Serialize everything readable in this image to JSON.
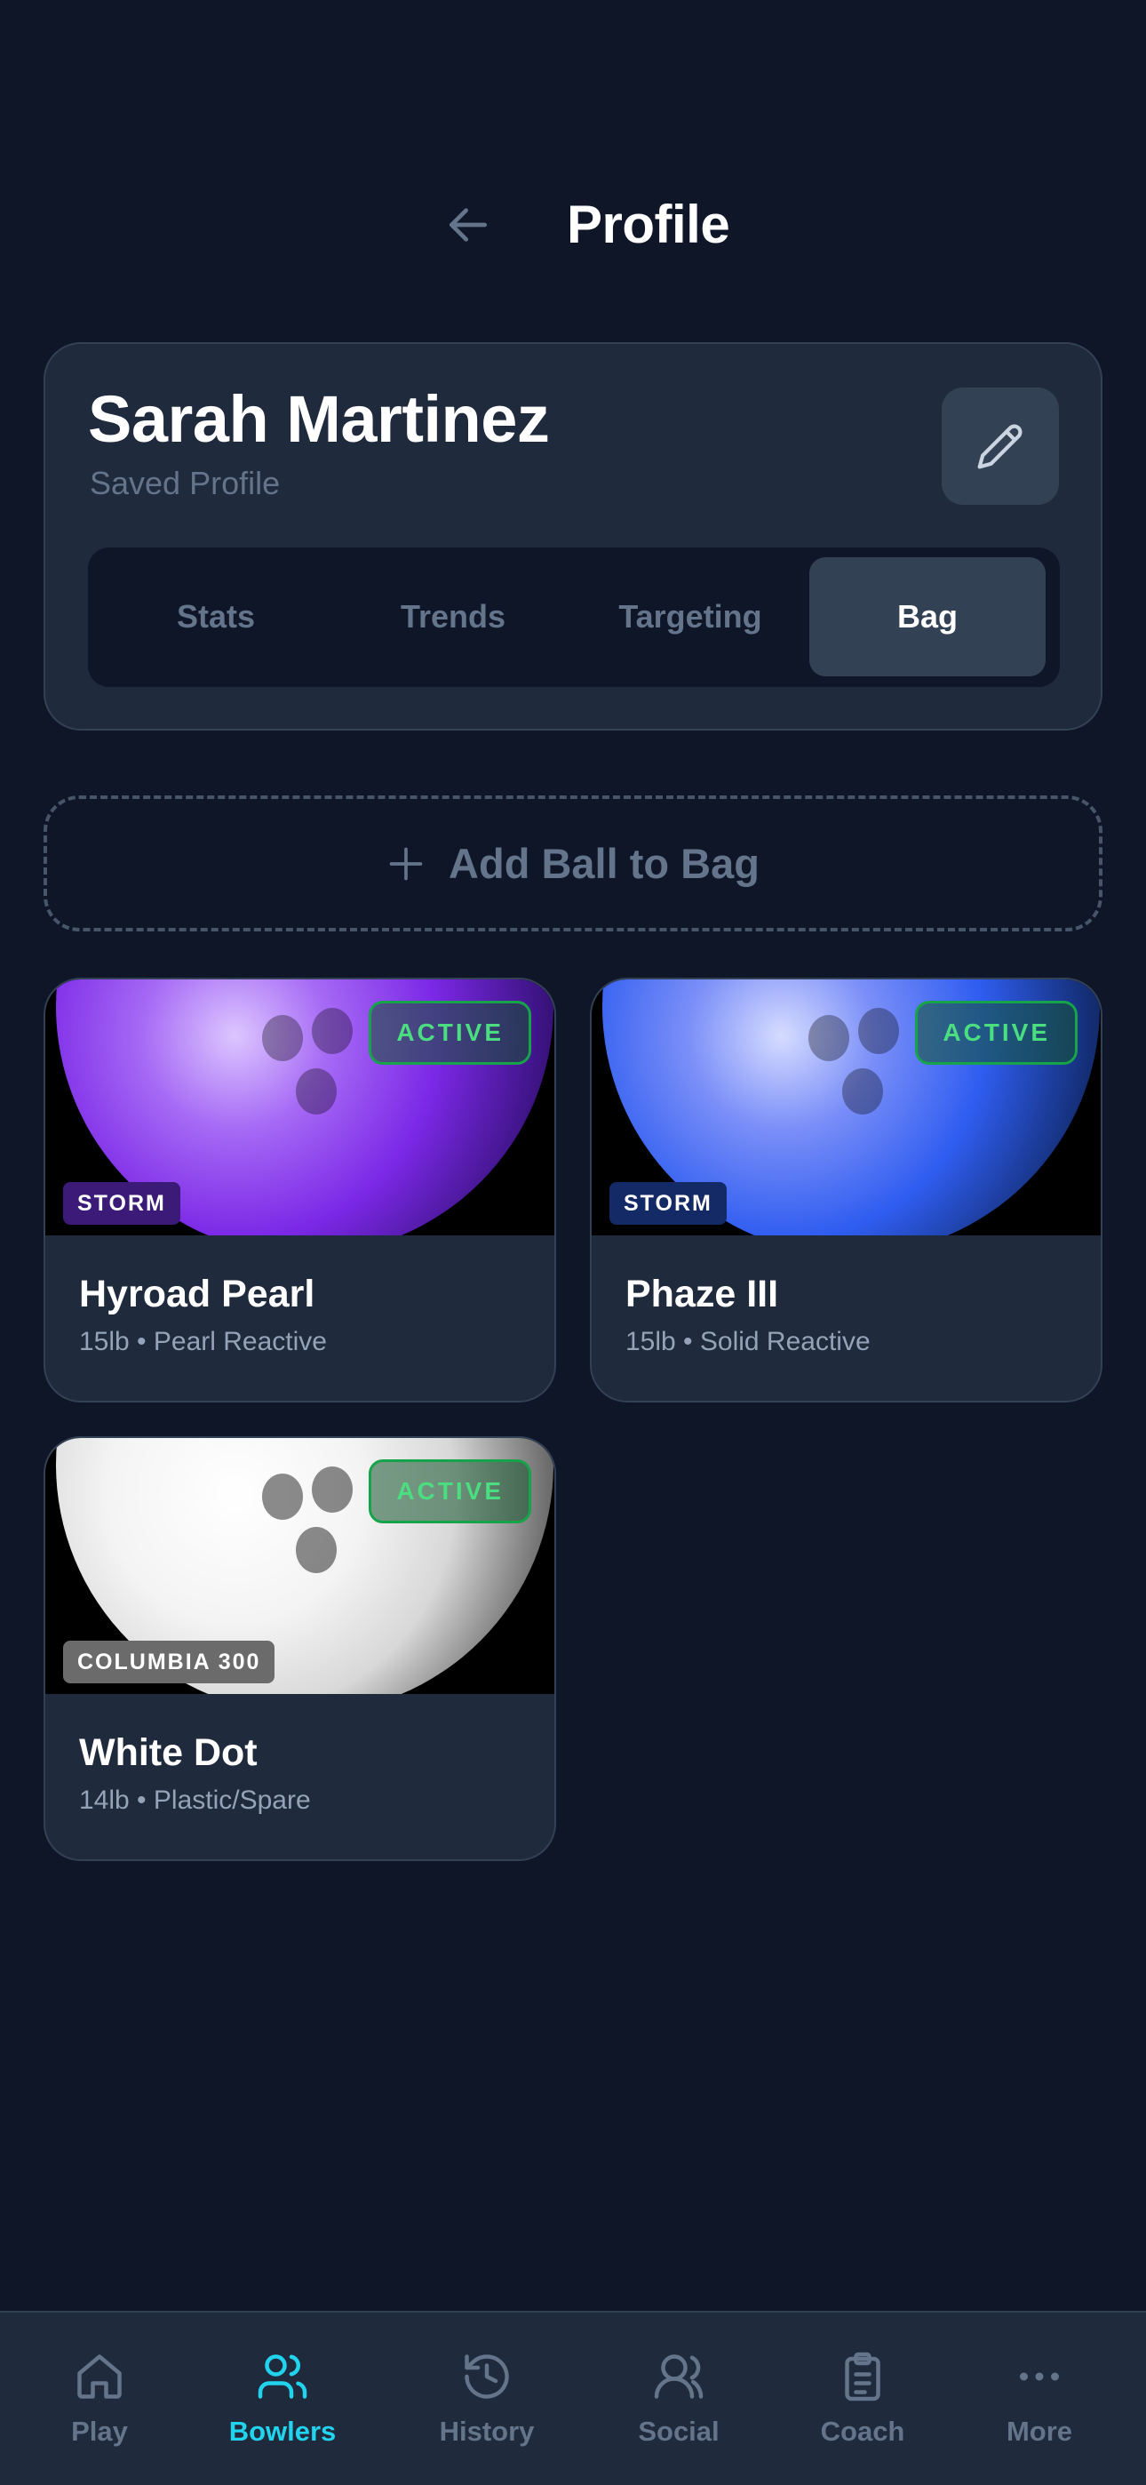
{
  "header": {
    "title": "Profile"
  },
  "profile": {
    "name": "Sarah Martinez",
    "subtitle": "Saved Profile",
    "tabs": [
      {
        "label": "Stats"
      },
      {
        "label": "Trends"
      },
      {
        "label": "Targeting"
      },
      {
        "label": "Bag"
      }
    ],
    "active_tab": "Bag"
  },
  "add_ball": {
    "label": "Add Ball to Bag"
  },
  "balls": [
    {
      "name": "Hyroad Pearl",
      "specs": "15lb • Pearl Reactive",
      "brand": "STORM",
      "status": "ACTIVE",
      "color": "#8b3cf0"
    },
    {
      "name": "Phaze III",
      "specs": "15lb • Solid Reactive",
      "brand": "STORM",
      "status": "ACTIVE",
      "color": "#2f5df0"
    },
    {
      "name": "White Dot",
      "specs": "14lb • Plastic/Spare",
      "brand": "COLUMBIA 300",
      "status": "ACTIVE",
      "color": "#f0f0f0"
    }
  ],
  "nav": {
    "items": [
      {
        "label": "Play",
        "icon": "home-icon"
      },
      {
        "label": "Bowlers",
        "icon": "users-icon"
      },
      {
        "label": "History",
        "icon": "history-icon"
      },
      {
        "label": "Social",
        "icon": "social-icon"
      },
      {
        "label": "Coach",
        "icon": "clipboard-icon"
      },
      {
        "label": "More",
        "icon": "more-icon"
      }
    ],
    "active": "Bowlers"
  },
  "colors": {
    "background": "#0e1628",
    "card": "#1f2a3c",
    "accent": "#22d3ee",
    "active_badge": "#4ade80"
  }
}
